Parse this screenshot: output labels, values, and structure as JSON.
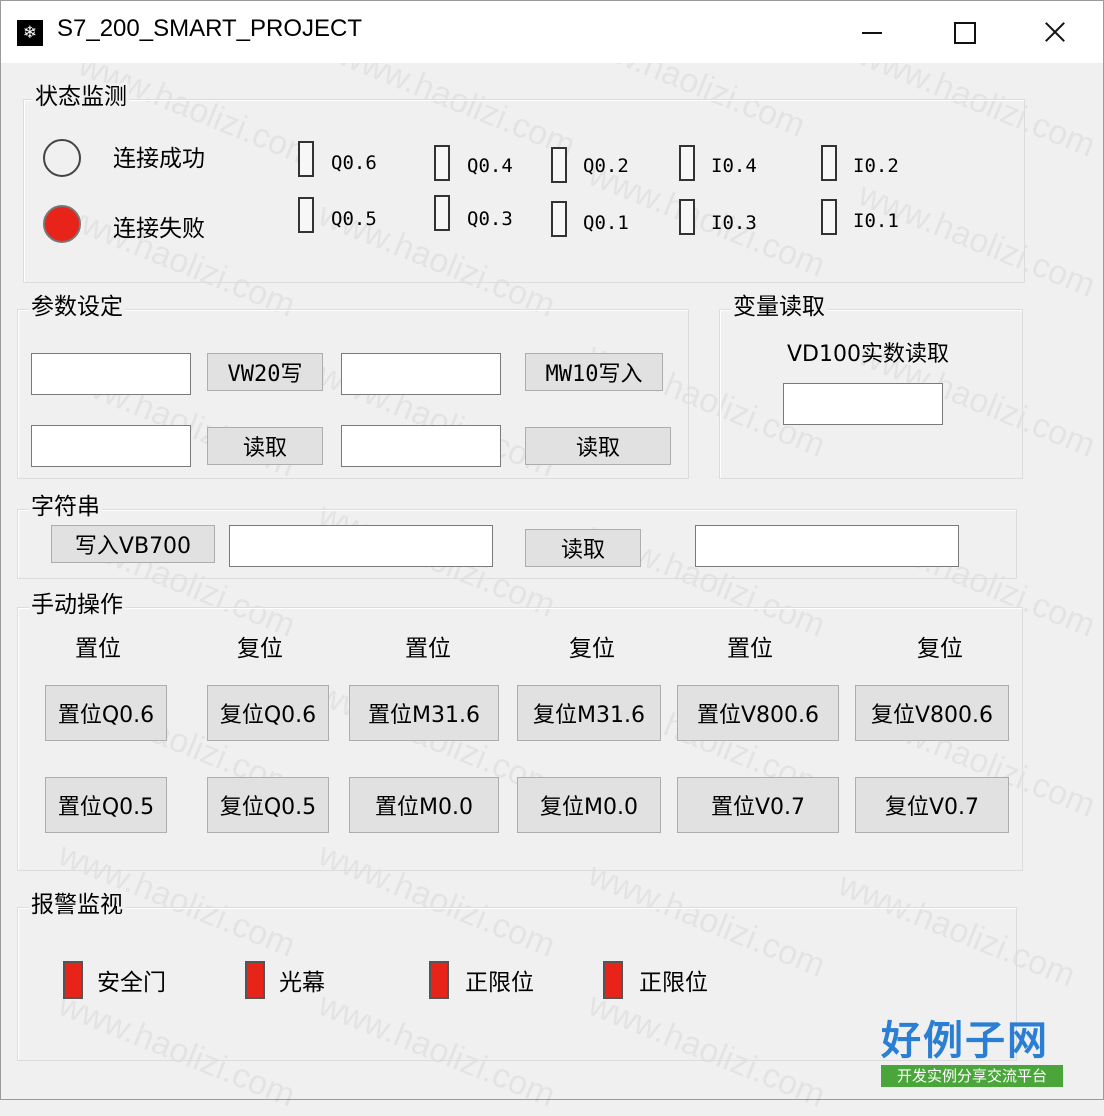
{
  "window": {
    "title": "S7_200_SMART_PROJECT",
    "icon": "snowflake-icon",
    "icon_glyph": "❄"
  },
  "status": {
    "group_label": "状态监测",
    "connect_ok": "连接成功",
    "connect_fail": "连接失败",
    "colors": {
      "ok_fill": "#ffffff",
      "fail_fill": "#e8231a"
    },
    "io": [
      "Q0.6",
      "Q0.5",
      "Q0.4",
      "Q0.3",
      "Q0.2",
      "Q0.1",
      "I0.4",
      "I0.3",
      "I0.2",
      "I0.1"
    ]
  },
  "params": {
    "group_label": "参数设定",
    "write_vw20": "VW20写",
    "write_mw10": "MW10写入",
    "read1": "读取",
    "read2": "读取"
  },
  "var_read": {
    "group_label": "变量读取",
    "vd100_label": "VD100实数读取"
  },
  "string": {
    "group_label": "字符串",
    "write_vb700": "写入VB700",
    "read": "读取"
  },
  "manual": {
    "group_label": "手动操作",
    "col_headers": [
      "置位",
      "复位",
      "置位",
      "复位",
      "置位",
      "复位"
    ],
    "row1": [
      "置位Q0.6",
      "复位Q0.6",
      "置位M31.6",
      "复位M31.6",
      "置位V800.6",
      "复位V800.6"
    ],
    "row2": [
      "置位Q0.5",
      "复位Q0.5",
      "置位M0.0",
      "复位M0.0",
      "置位V0.7",
      "复位V0.7"
    ]
  },
  "alarm": {
    "group_label": "报警监视",
    "color": "#e8231a",
    "items": [
      "安全门",
      "光幕",
      "正限位",
      "正限位"
    ]
  },
  "watermark": {
    "text": "www.haolizi.com",
    "brand": "好例子网",
    "brand_sub": "开发实例分享交流平台"
  }
}
